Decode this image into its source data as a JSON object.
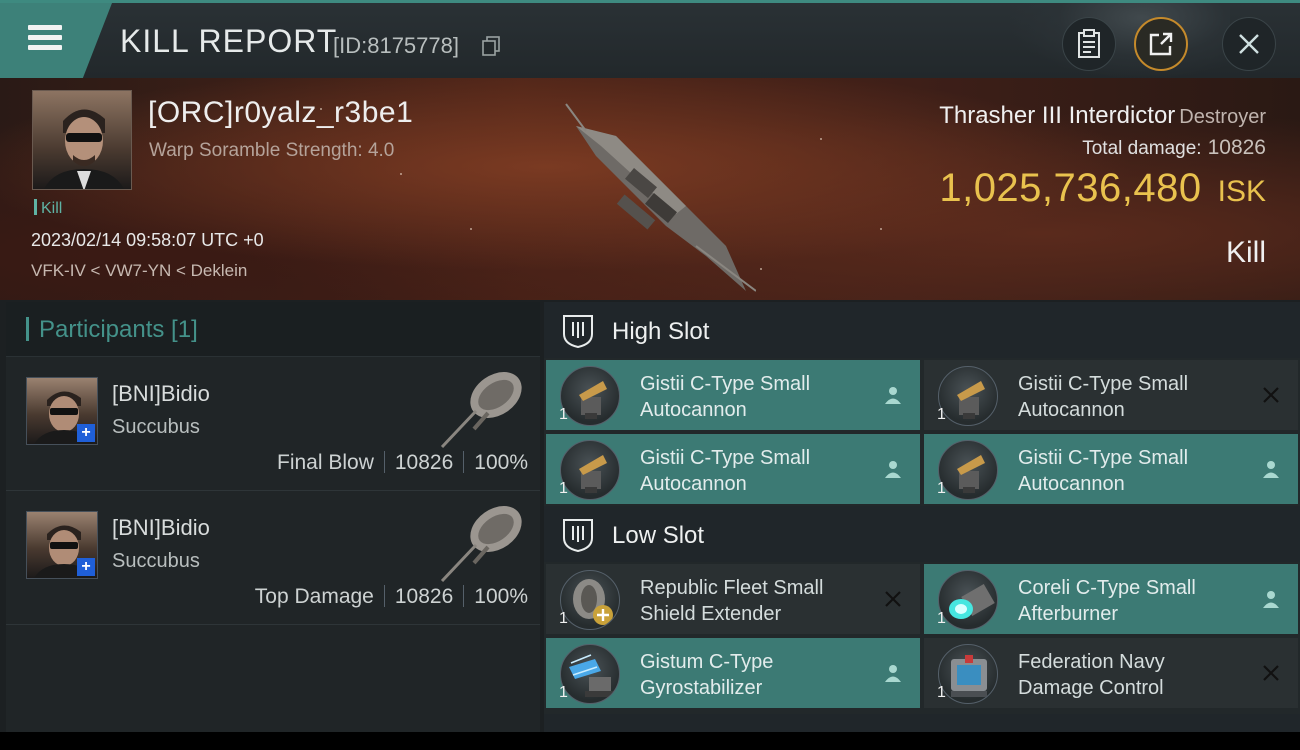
{
  "header": {
    "title": "KILL REPORT",
    "report_id": "[ID:8175778]"
  },
  "victim": {
    "name": "[ORC]r0yalz_r3be1",
    "subline": "Warp Soramble Strength: 4.0",
    "tag": "Kill",
    "datetime": "2023/02/14 09:58:07 UTC +0",
    "location": "VFK-IV < VW7-YN < Deklein"
  },
  "ship": {
    "name": "Thrasher III Interdictor",
    "class": "Destroyer",
    "total_damage_label": "Total damage:",
    "total_damage": "10826",
    "isk_value": "1,025,736,480",
    "isk_unit": "ISK",
    "result": "Kill"
  },
  "participants": {
    "title": "Participants [1]",
    "rows": [
      {
        "name": "[BNI]Bidio",
        "ship": "Succubus",
        "role": "Final Blow",
        "damage": "10826",
        "percent": "100%"
      },
      {
        "name": "[BNI]Bidio",
        "ship": "Succubus",
        "role": "Top Damage",
        "damage": "10826",
        "percent": "100%"
      }
    ]
  },
  "fitting": {
    "high_slot": {
      "label": "High Slot",
      "modules": [
        {
          "qty": "1",
          "line1": "Gistii C-Type Small",
          "line2": "Autocannon",
          "status": "fitted"
        },
        {
          "qty": "1",
          "line1": "Gistii C-Type Small",
          "line2": "Autocannon",
          "status": "destroyed"
        },
        {
          "qty": "1",
          "line1": "Gistii C-Type Small",
          "line2": "Autocannon",
          "status": "fitted"
        },
        {
          "qty": "1",
          "line1": "Gistii C-Type Small",
          "line2": "Autocannon",
          "status": "fitted"
        }
      ]
    },
    "low_slot": {
      "label": "Low Slot",
      "modules": [
        {
          "qty": "1",
          "line1": "Republic Fleet Small",
          "line2": "Shield Extender",
          "status": "destroyed"
        },
        {
          "qty": "1",
          "line1": "Coreli C-Type Small",
          "line2": "Afterburner",
          "status": "fitted"
        },
        {
          "qty": "1",
          "line1": "Gistum C-Type",
          "line2": "Gyrostabilizer",
          "status": "fitted"
        },
        {
          "qty": "1",
          "line1": "Federation Navy",
          "line2": "Damage Control",
          "status": "destroyed"
        }
      ]
    }
  },
  "colors": {
    "accent_teal": "#3c7a74",
    "isk_gold": "#e9c24e",
    "participant_title": "#44928a"
  }
}
